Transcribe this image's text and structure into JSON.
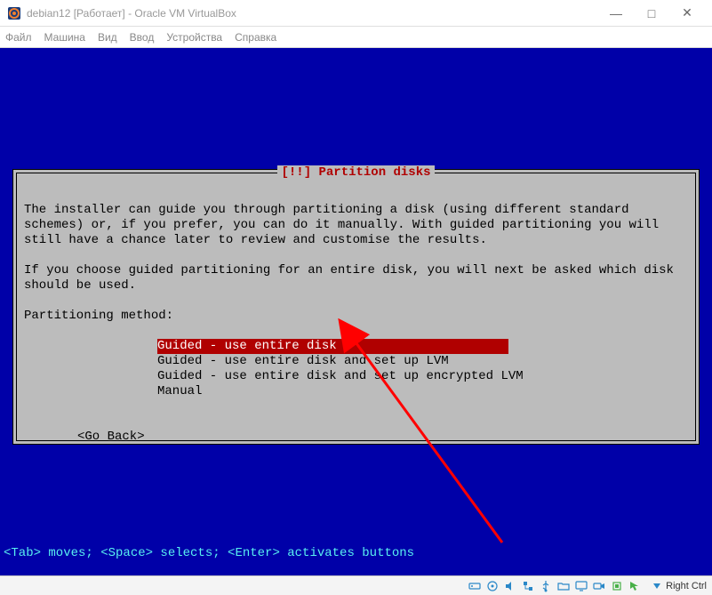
{
  "window": {
    "title": "debian12 [Работает] - Oracle VM VirtualBox"
  },
  "menu": {
    "items": [
      "Файл",
      "Машина",
      "Вид",
      "Ввод",
      "Устройства",
      "Справка"
    ]
  },
  "dialog": {
    "title": "[!!] Partition disks",
    "para1": "The installer can guide you through partitioning a disk (using different standard\nschemes) or, if you prefer, you can do it manually. With guided partitioning you will\nstill have a chance later to review and customise the results.",
    "para2": "If you choose guided partitioning for an entire disk, you will next be asked which disk\nshould be used.",
    "prompt": "Partitioning method:",
    "options": [
      "Guided - use entire disk",
      "Guided - use entire disk and set up LVM",
      "Guided - use entire disk and set up encrypted LVM",
      "Manual"
    ],
    "selected_index": 0,
    "selected_padded": "Guided - use entire disk                       ",
    "go_back": "<Go Back>"
  },
  "hint": "<Tab> moves; <Space> selects; <Enter> activates buttons",
  "status": {
    "hostkey": "Right Ctrl"
  }
}
